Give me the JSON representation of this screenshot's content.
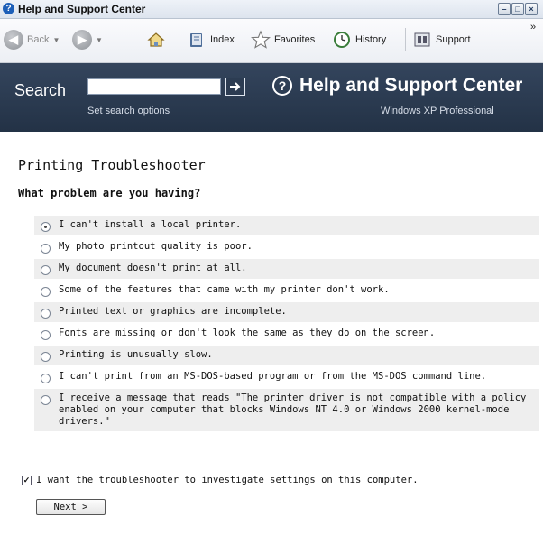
{
  "window": {
    "title": "Help and Support Center",
    "icon": "help-question-icon",
    "controls": [
      "minimize-icon",
      "maximize-icon",
      "close-icon"
    ]
  },
  "toolbar": {
    "back_label": "Back",
    "forward_icon": "forward-arrow-icon",
    "home_icon": "home-icon",
    "index_label": "Index",
    "favorites_label": "Favorites",
    "history_label": "History",
    "support_label": "Support",
    "overflow": "»"
  },
  "header": {
    "search_label": "Search",
    "search_value": "",
    "search_options": "Set search options",
    "title": "Help and Support Center",
    "os_name": "Windows XP Professional"
  },
  "content": {
    "page_title": "Printing Troubleshooter",
    "question": "What problem are you having?",
    "options": [
      {
        "label": "I can't install a local printer.",
        "selected": true
      },
      {
        "label": "My photo printout quality is poor.",
        "selected": false
      },
      {
        "label": "My document doesn't print at all.",
        "selected": false
      },
      {
        "label": "Some of the features that came with my printer don't work.",
        "selected": false
      },
      {
        "label": "Printed text or graphics are incomplete.",
        "selected": false
      },
      {
        "label": "Fonts are missing or don't look the same as they do on the screen.",
        "selected": false
      },
      {
        "label": "Printing is unusually slow.",
        "selected": false
      },
      {
        "label": "I can't print from an MS-DOS-based program or from the MS-DOS command line.",
        "selected": false
      },
      {
        "label": "I receive a message that reads \"The printer driver is not compatible with a policy enabled on your computer that blocks Windows NT 4.0 or Windows 2000 kernel-mode drivers.\"",
        "selected": false
      }
    ],
    "investigate_label": "I want the troubleshooter to investigate settings on this computer.",
    "investigate_checked": true,
    "next_label": "Next >"
  },
  "colors": {
    "header_bg": "#2a3a50",
    "row_alt": "#eeeeee"
  }
}
